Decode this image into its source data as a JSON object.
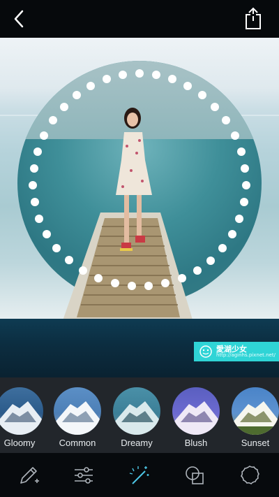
{
  "header": {
    "back_icon": "chevron-left-icon",
    "share_icon": "share-icon"
  },
  "watermark": {
    "title": "愛湖少女",
    "url": "http://aginhs.pixnet.net/"
  },
  "filters": [
    {
      "label": "Gloomy"
    },
    {
      "label": "Common"
    },
    {
      "label": "Dreamy"
    },
    {
      "label": "Blush"
    },
    {
      "label": "Sunset"
    }
  ],
  "toolbar": {
    "tools": [
      "pencil-plus-icon",
      "sliders-icon",
      "magic-wand-icon",
      "overlap-squares-icon",
      "scalloped-circle-icon"
    ]
  },
  "colors": {
    "accent_watermark": "#2fd4d6",
    "active_tool": "#4dc7e6"
  }
}
